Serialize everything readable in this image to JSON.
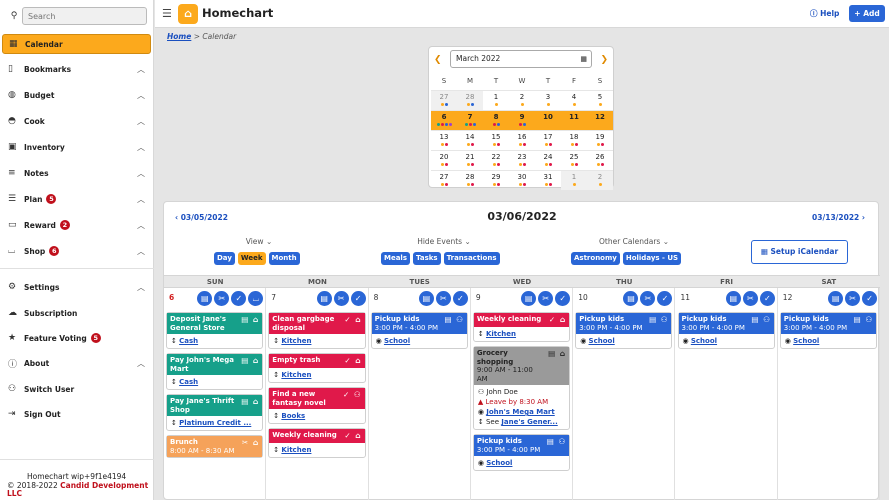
{
  "search": {
    "placeholder": "Search"
  },
  "sidebar": {
    "items": [
      {
        "label": "Calendar",
        "icon": "calendar-icon",
        "active": true
      },
      {
        "label": "Bookmarks",
        "icon": "bookmark-icon"
      },
      {
        "label": "Budget",
        "icon": "piggy-bank-icon"
      },
      {
        "label": "Cook",
        "icon": "pot-icon"
      },
      {
        "label": "Inventory",
        "icon": "box-icon"
      },
      {
        "label": "Notes",
        "icon": "notes-icon"
      },
      {
        "label": "Plan",
        "icon": "checklist-icon",
        "badge": "5"
      },
      {
        "label": "Reward",
        "icon": "ticket-icon",
        "badge": "2"
      },
      {
        "label": "Shop",
        "icon": "cart-icon",
        "badge": "6"
      },
      {
        "label": "Settings",
        "icon": "gear-icon"
      },
      {
        "label": "Subscription",
        "icon": "cloud-icon"
      },
      {
        "label": "Feature Voting",
        "icon": "star-icon",
        "badge": "5"
      },
      {
        "label": "About",
        "icon": "info-icon"
      },
      {
        "label": "Switch User",
        "icon": "switch-user-icon"
      },
      {
        "label": "Sign Out",
        "icon": "sign-out-icon"
      }
    ],
    "footer": {
      "version": "Homechart wip+9f1e4194",
      "copyright": "© 2018-2022",
      "company": "Candid Development LLC"
    }
  },
  "header": {
    "brand": "Homechart",
    "help": "Help",
    "add": "Add"
  },
  "breadcrumb": {
    "home": "Home",
    "sep": ">",
    "current": "Calendar"
  },
  "mini_calendar": {
    "month": "March 2022",
    "weekdays": [
      "S",
      "M",
      "T",
      "W",
      "T",
      "F",
      "S"
    ],
    "weeks": [
      [
        "27",
        "28",
        "1",
        "2",
        "3",
        "4",
        "5"
      ],
      [
        "6",
        "7",
        "8",
        "9",
        "10",
        "11",
        "12"
      ],
      [
        "13",
        "14",
        "15",
        "16",
        "17",
        "18",
        "19"
      ],
      [
        "20",
        "21",
        "22",
        "23",
        "24",
        "25",
        "26"
      ],
      [
        "27",
        "28",
        "29",
        "30",
        "31",
        "1",
        "2"
      ]
    ]
  },
  "week": {
    "prev": "03/05/2022",
    "title": "03/06/2022",
    "next": "03/13/2022",
    "view_label": "View",
    "view_buttons": [
      "Day",
      "Week",
      "Month"
    ],
    "hide_label": "Hide Events",
    "hide_buttons": [
      "Meals",
      "Tasks",
      "Transactions"
    ],
    "other_label": "Other Calendars",
    "other_buttons": [
      "Astronomy",
      "Holidays - US"
    ],
    "ical": "Setup iCalendar",
    "days": [
      "SUN",
      "MON",
      "TUES",
      "WED",
      "THU",
      "FRI",
      "SAT"
    ],
    "dates": [
      "6",
      "7",
      "8",
      "9",
      "10",
      "11",
      "12"
    ]
  },
  "columns": [
    [
      {
        "title": "Deposit Jane's General Store",
        "color": "green",
        "icons": "▤ ⌂",
        "body": [
          {
            "t": "link",
            "v": "Cash"
          }
        ]
      },
      {
        "title": "Pay John's Mega Mart",
        "color": "green",
        "icons": "▤ ⌂",
        "body": [
          {
            "t": "link",
            "v": "Cash"
          }
        ]
      },
      {
        "title": "Pay Jane's Thrift Shop",
        "color": "green",
        "icons": "▤ ⌂",
        "body": [
          {
            "t": "link",
            "v": "Platinum Credit ..."
          }
        ]
      },
      {
        "title": "Brunch",
        "time": "8:00 AM - 8:30 AM",
        "color": "orange",
        "icons": "✂ ⌂",
        "body": []
      }
    ],
    [
      {
        "title": "Clean gargbage disposal",
        "color": "red",
        "icons": "✓ ⌂",
        "body": [
          {
            "t": "link",
            "v": "Kitchen"
          }
        ]
      },
      {
        "title": "Empty trash",
        "color": "red",
        "icons": "✓ ⌂",
        "body": [
          {
            "t": "link",
            "v": "Kitchen"
          }
        ]
      },
      {
        "title": "Find a new fantasy novel",
        "color": "red",
        "icons": "✓ ⚇",
        "body": [
          {
            "t": "link",
            "v": "Books"
          }
        ]
      },
      {
        "title": "Weekly cleaning",
        "color": "red",
        "icons": "✓ ⌂",
        "body": [
          {
            "t": "link",
            "v": "Kitchen"
          }
        ]
      }
    ],
    [
      {
        "title": "Pickup kids",
        "time": "3:00 PM - 4:00 PM",
        "color": "blue",
        "icons": "▤ ⚇",
        "body": [
          {
            "t": "link",
            "v": "School"
          }
        ]
      }
    ],
    [
      {
        "title": "Weekly cleaning",
        "color": "red",
        "icons": "✓ ⌂",
        "body": [
          {
            "t": "link",
            "v": "Kitchen"
          }
        ]
      },
      {
        "title": "Grocery shopping",
        "time": "9:00 AM - 11:00 AM",
        "color": "gray",
        "icons": "▤ ⌂",
        "body": [
          {
            "t": "text",
            "v": "John Doe"
          },
          {
            "t": "red",
            "v": "Leave by 8:30 AM"
          },
          {
            "t": "link",
            "v": "John's Mega Mart"
          },
          {
            "t": "see",
            "v": "Jane's Gener..."
          }
        ]
      },
      {
        "title": "Pickup kids",
        "time": "3:00 PM - 4:00 PM",
        "color": "blue",
        "icons": "▤ ⚇",
        "body": [
          {
            "t": "link",
            "v": "School"
          }
        ]
      }
    ],
    [
      {
        "title": "Pickup kids",
        "time": "3:00 PM - 4:00 PM",
        "color": "blue",
        "icons": "▤ ⚇",
        "body": [
          {
            "t": "link",
            "v": "School"
          }
        ]
      }
    ],
    [
      {
        "title": "Pickup kids",
        "time": "3:00 PM - 4:00 PM",
        "color": "blue",
        "icons": "▤ ⚇",
        "body": [
          {
            "t": "link",
            "v": "School"
          }
        ]
      }
    ],
    [
      {
        "title": "Pickup kids",
        "time": "3:00 PM - 4:00 PM",
        "color": "blue",
        "icons": "▤ ⚇",
        "body": [
          {
            "t": "link",
            "v": "School"
          }
        ]
      }
    ]
  ],
  "see_prefix": "See",
  "colors": {
    "accent": "#fca91c",
    "primary": "#2a66d6",
    "danger": "#c0101c"
  }
}
